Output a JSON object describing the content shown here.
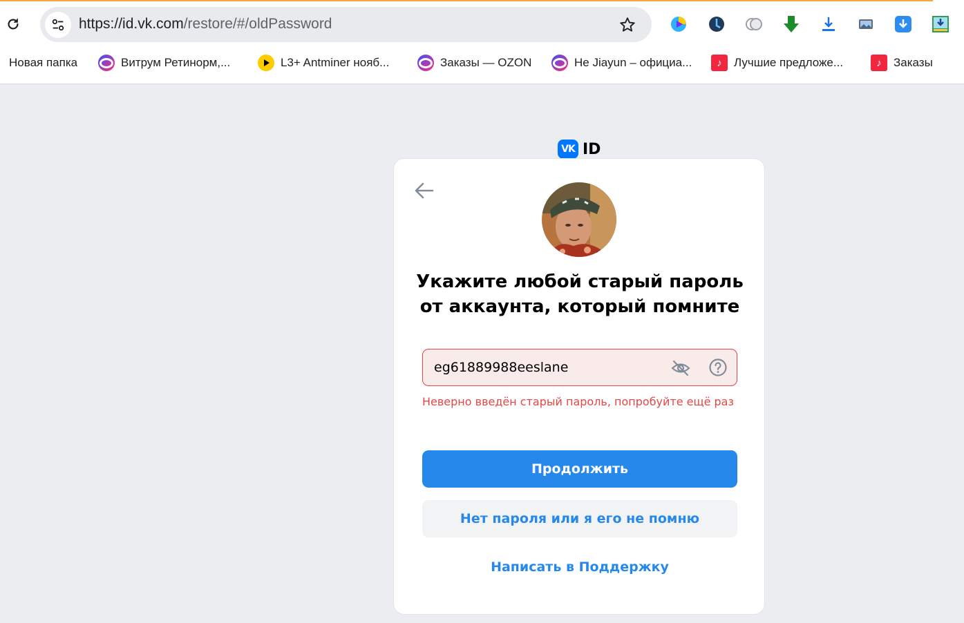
{
  "browser": {
    "url_host": "https://id.vk.com",
    "url_path": "/restore/#/oldPassword",
    "bookmarks": [
      {
        "label": "Новая папка",
        "icon": "folder-icon"
      },
      {
        "label": "Витрум Ретинорм,...",
        "icon": "ozon-icon"
      },
      {
        "label": "L3+ Antminer нояб...",
        "icon": "play-icon"
      },
      {
        "label": "Заказы — OZON",
        "icon": "ozon-icon"
      },
      {
        "label": "Не Jiayun – официа...",
        "icon": "ozon-icon"
      },
      {
        "label": "Лучшие предложе...",
        "icon": "mvideo-icon"
      },
      {
        "label": "Заказы",
        "icon": "mvideo-icon"
      }
    ],
    "extensions": [
      "colorful-extension-icon",
      "dark-circle-extension-icon",
      "grey-puzzle-extension-icon",
      "green-download-arrow-icon",
      "download-tray-icon",
      "picture-extension-icon",
      "blue-download-icon",
      "image-download-icon"
    ],
    "colors": {
      "accent_bar": "#f3a93c"
    }
  },
  "page": {
    "logo_square": "VK",
    "logo_text": "ID",
    "title": "Укажите любой старый пароль от аккаунта, который помните",
    "password_value": "eg61889988eeslane",
    "error_text": "Неверно введён старый пароль, попробуйте ещё раз",
    "continue_label": "Продолжить",
    "no_password_label": "Нет пароля или я его не помню",
    "support_label": "Написать в Поддержку",
    "colors": {
      "primary": "#2688eb",
      "error": "#e64646",
      "vk_blue": "#0077ff"
    }
  }
}
